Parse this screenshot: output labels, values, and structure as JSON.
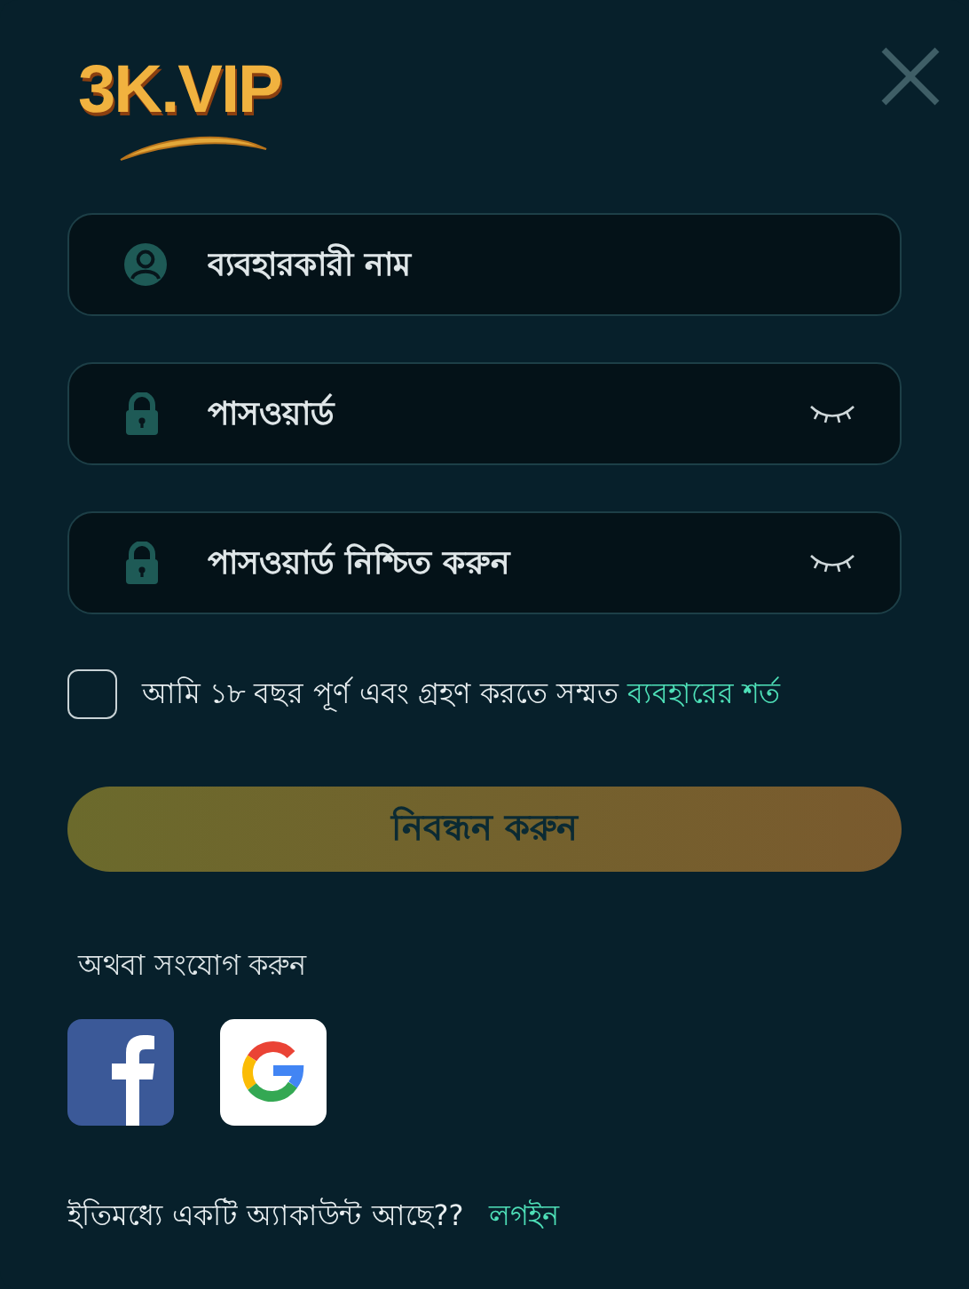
{
  "logo": {
    "text": "3K.VIP"
  },
  "fields": [
    {
      "kind": "username",
      "placeholder": "ব্যবহারকারী নাম"
    },
    {
      "kind": "password",
      "placeholder": "পাসওয়ার্ড"
    },
    {
      "kind": "password",
      "placeholder": "পাসওয়ার্ড নিশ্চিত করুন"
    }
  ],
  "agreement": {
    "checked": false,
    "text": "আমি ১৮ বছর পূর্ণ এবং গ্রহণ করতে সম্মত",
    "link": "ব্যবহারের শর্ত"
  },
  "submit_button": "নিবন্ধন করুন",
  "social": {
    "heading": "অথবা সংযোগ করুন",
    "providers": [
      {
        "kind": "facebook"
      },
      {
        "kind": "google"
      }
    ]
  },
  "footer": {
    "text": "ইতিমধ্যে একটি অ্যাকাউন্ট আছে??",
    "link": "লগইন"
  }
}
